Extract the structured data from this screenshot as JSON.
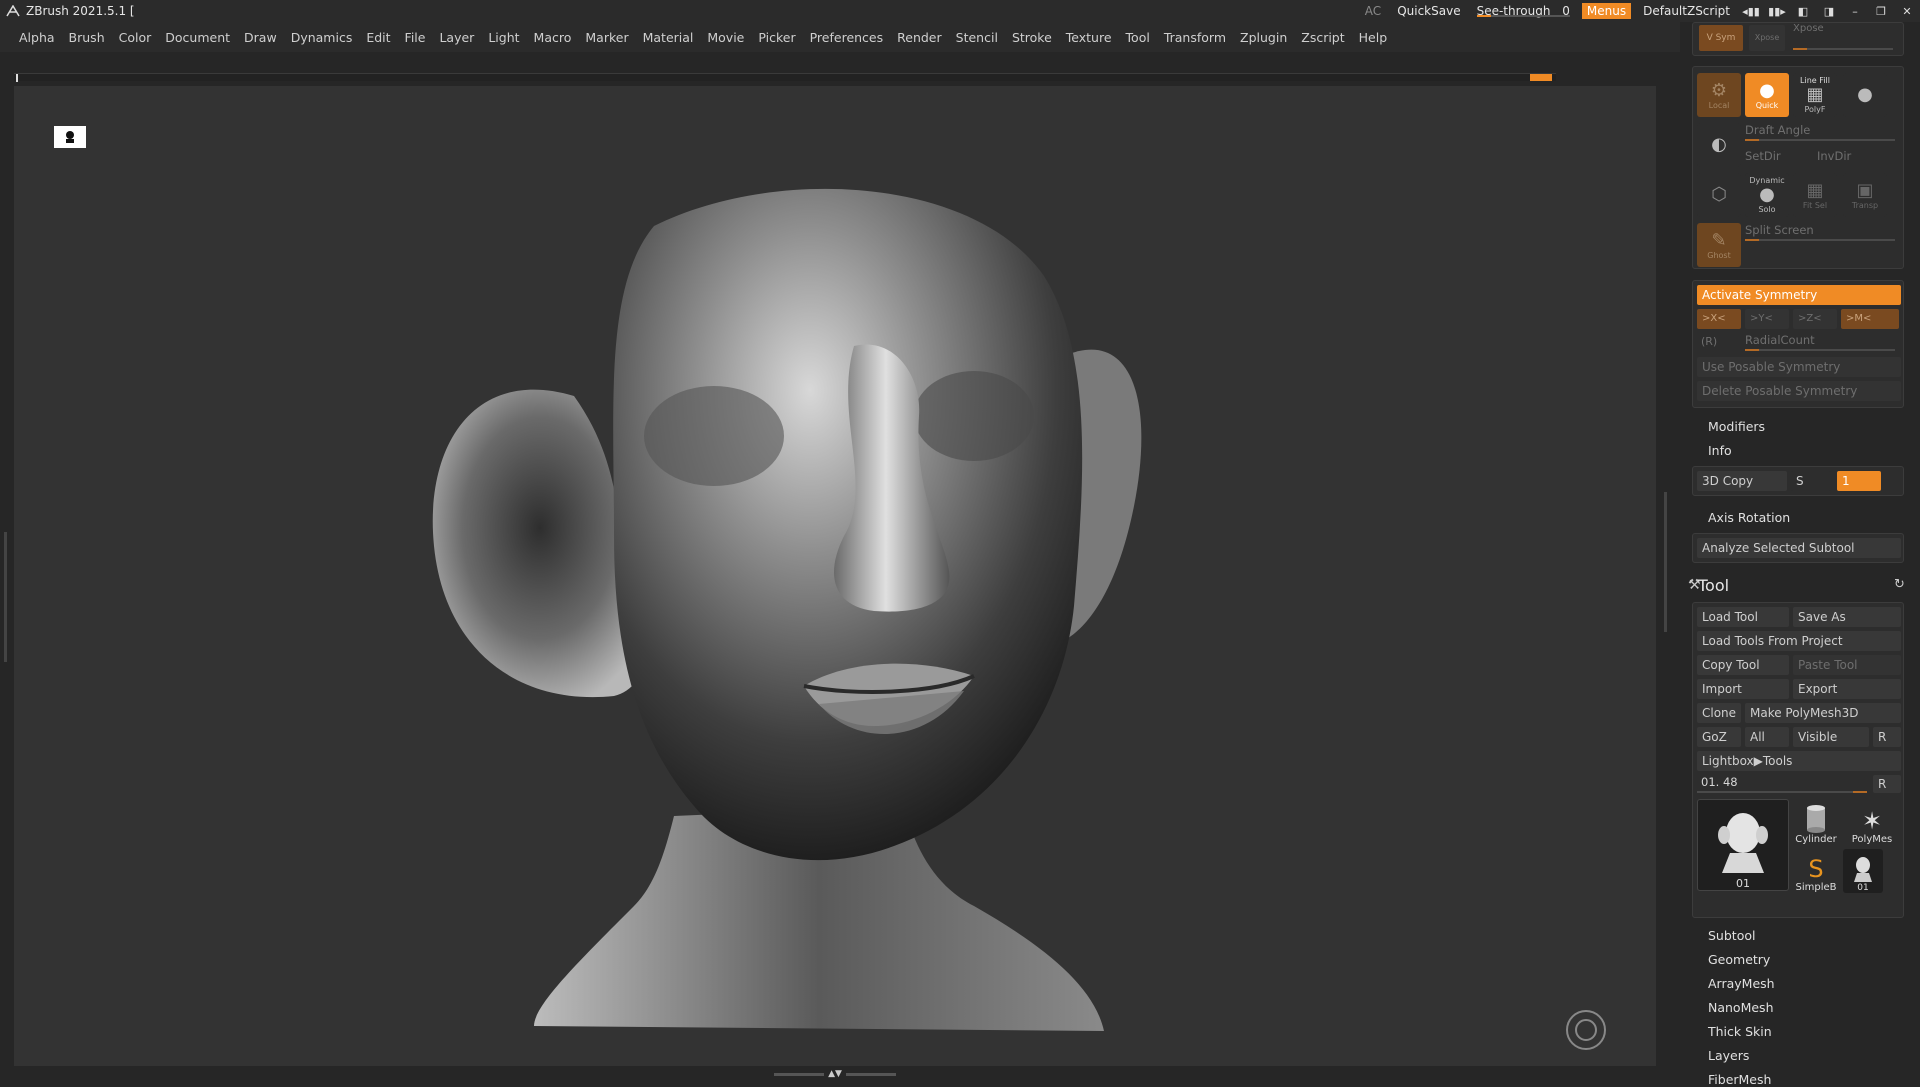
{
  "titlebar": {
    "app_title": "ZBrush 2021.5.1 [",
    "ac": "AC",
    "quicksave": "QuickSave",
    "seethrough_label": "See-through",
    "seethrough_value": "0",
    "seethrough_level": 0,
    "menus": "Menus",
    "zscript": "DefaultZScript",
    "accent": "#f08b25"
  },
  "menubar": {
    "items": [
      "Alpha",
      "Brush",
      "Color",
      "Document",
      "Draw",
      "Dynamics",
      "Edit",
      "File",
      "Layer",
      "Light",
      "Macro",
      "Marker",
      "Material",
      "Movie",
      "Picker",
      "Preferences",
      "Render",
      "Stencil",
      "Stroke",
      "Texture",
      "Tool",
      "Transform",
      "Zplugin",
      "Zscript",
      "Help"
    ]
  },
  "viewport": {
    "model": "sculpted head bust"
  },
  "panel": {
    "top": {
      "vsym": "V Sym",
      "xpose": "Xpose"
    },
    "transform": {
      "local": "Local",
      "quick": "Quick",
      "linefill_header": "Line Fill",
      "polyf": "PolyF",
      "draft_angle": "Draft Angle",
      "setdir": "SetDir",
      "invdir": "InvDir",
      "dynamic": "Dynamic",
      "solo": "Solo",
      "fitsel": "Fit Sel",
      "transp": "Transp",
      "ghost": "Ghost",
      "split_screen": "Split Screen"
    },
    "symmetry": {
      "activate": "Activate Symmetry",
      "x": ">X<",
      "y": ">Y<",
      "z": ">Z<",
      "m": ">M<",
      "r": "(R)",
      "radial": "RadialCount",
      "use_posable": "Use Posable Symmetry",
      "delete_posable": "Delete Posable Symmetry"
    },
    "modifiers": "Modifiers",
    "info": "Info",
    "copy3d": {
      "label": "3D Copy",
      "s": "S",
      "value": "1"
    },
    "axis_rotation": "Axis Rotation",
    "analyze": "Analyze Selected Subtool",
    "tool": {
      "title": "Tool",
      "load_tool": "Load Tool",
      "save_as": "Save As",
      "load_from_project": "Load Tools From Project",
      "copy_tool": "Copy Tool",
      "paste_tool": "Paste Tool",
      "import": "Import",
      "export": "Export",
      "clone": "Clone",
      "make_polymesh": "Make PolyMesh3D",
      "goz": "GoZ",
      "all": "All",
      "visible": "Visible",
      "r": "R",
      "lightbox": "Lightbox▶Tools",
      "current": "01. 48",
      "current_r": "R",
      "thumbs": {
        "main": "01",
        "cylinder": "Cylinder",
        "polymesh": "PolyMes",
        "simpleb": "SimpleB",
        "small": "01"
      }
    },
    "sections": [
      "Subtool",
      "Geometry",
      "ArrayMesh",
      "NanoMesh",
      "Thick Skin",
      "Layers",
      "FiberMesh"
    ]
  }
}
